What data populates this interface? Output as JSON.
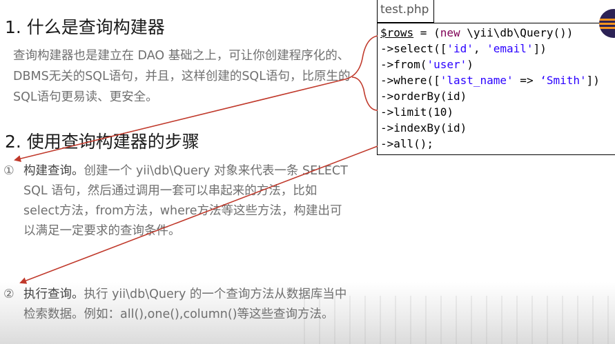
{
  "section1": {
    "title": "1. 什么是查询构建器",
    "description": "查询构建器也是建立在 DAO 基础之上，可让你创建程序化的、DBMS无关的SQL语句，并且，这样创建的SQL语句，比原生的SQL语句更易读、更安全。"
  },
  "section2": {
    "title": "2. 使用查询构建器的步骤",
    "steps": [
      {
        "number": "①",
        "lead": "构建查询。",
        "text": "创建一个 yii\\db\\Query 对象来代表一条 SELECT SQL 语句，然后通过调用一套可以串起来的方法，比如select方法，from方法，where方法等这些方法，构建出可以满足一定要求的查询条件。"
      },
      {
        "number": "②",
        "lead": "执行查询。",
        "text": "执行 yii\\db\\Query 的一个查询方法从数据库当中检索数据。例如：all(),one(),column()等这些查询方法。"
      }
    ]
  },
  "code_panel": {
    "filename": "test.php",
    "lines": [
      [
        {
          "t": "$rows",
          "c": "var"
        },
        {
          "t": " = (",
          "c": ""
        },
        {
          "t": "new",
          "c": "kw"
        },
        {
          "t": " \\yii\\db\\Query())",
          "c": ""
        }
      ],
      [
        {
          "t": "->select([",
          "c": ""
        },
        {
          "t": "'id'",
          "c": "str"
        },
        {
          "t": ", ",
          "c": ""
        },
        {
          "t": "'email'",
          "c": "str"
        },
        {
          "t": "])",
          "c": ""
        }
      ],
      [
        {
          "t": "->from(",
          "c": ""
        },
        {
          "t": "'user'",
          "c": "str"
        },
        {
          "t": ")",
          "c": ""
        }
      ],
      [
        {
          "t": "->where([",
          "c": ""
        },
        {
          "t": "'last_name'",
          "c": "str"
        },
        {
          "t": " => ",
          "c": ""
        },
        {
          "t": "‘Smith'",
          "c": "str"
        },
        {
          "t": "])",
          "c": ""
        }
      ],
      [
        {
          "t": "->orderBy(id)",
          "c": ""
        }
      ],
      [
        {
          "t": "->limit(10)",
          "c": ""
        }
      ],
      [
        {
          "t": "->indexBy(id)",
          "c": ""
        }
      ],
      [
        {
          "t": "->all();",
          "c": ""
        }
      ]
    ]
  },
  "colors": {
    "keyword": "#7f0055",
    "string": "#2a00ff",
    "arrow": "#c0392b",
    "body_text": "#6f6f6f"
  },
  "icons": {
    "logo": "eclipse-logo-icon"
  }
}
